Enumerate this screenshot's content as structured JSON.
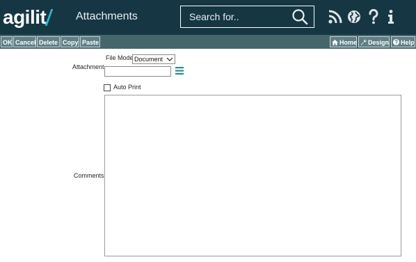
{
  "header": {
    "logo_text": "agilit",
    "title": "Attachments",
    "search_placeholder": "Search for..",
    "icons": [
      "rss-icon",
      "globe-icon",
      "help-question-icon",
      "info-icon"
    ]
  },
  "toolbar": {
    "left_buttons": [
      "OK",
      "Cancel",
      "Delete",
      "Copy",
      "Paste"
    ],
    "home_label": "Home",
    "design_label": "Design",
    "help_label": "Help"
  },
  "form": {
    "file_mode_label": "File Mode",
    "file_mode_value": "Document",
    "attachment_label": "Attachment",
    "attachment_value": "",
    "auto_print_label": "Auto Print",
    "auto_print_checked": false,
    "comments_label": "Comments",
    "comments_value": ""
  },
  "colors": {
    "header_bg": "#163643",
    "toolbar_bg": "#46666c",
    "button_bg": "#5f7f85",
    "accent": "#2bb7c4",
    "menu_icon": "#2b8a92"
  }
}
